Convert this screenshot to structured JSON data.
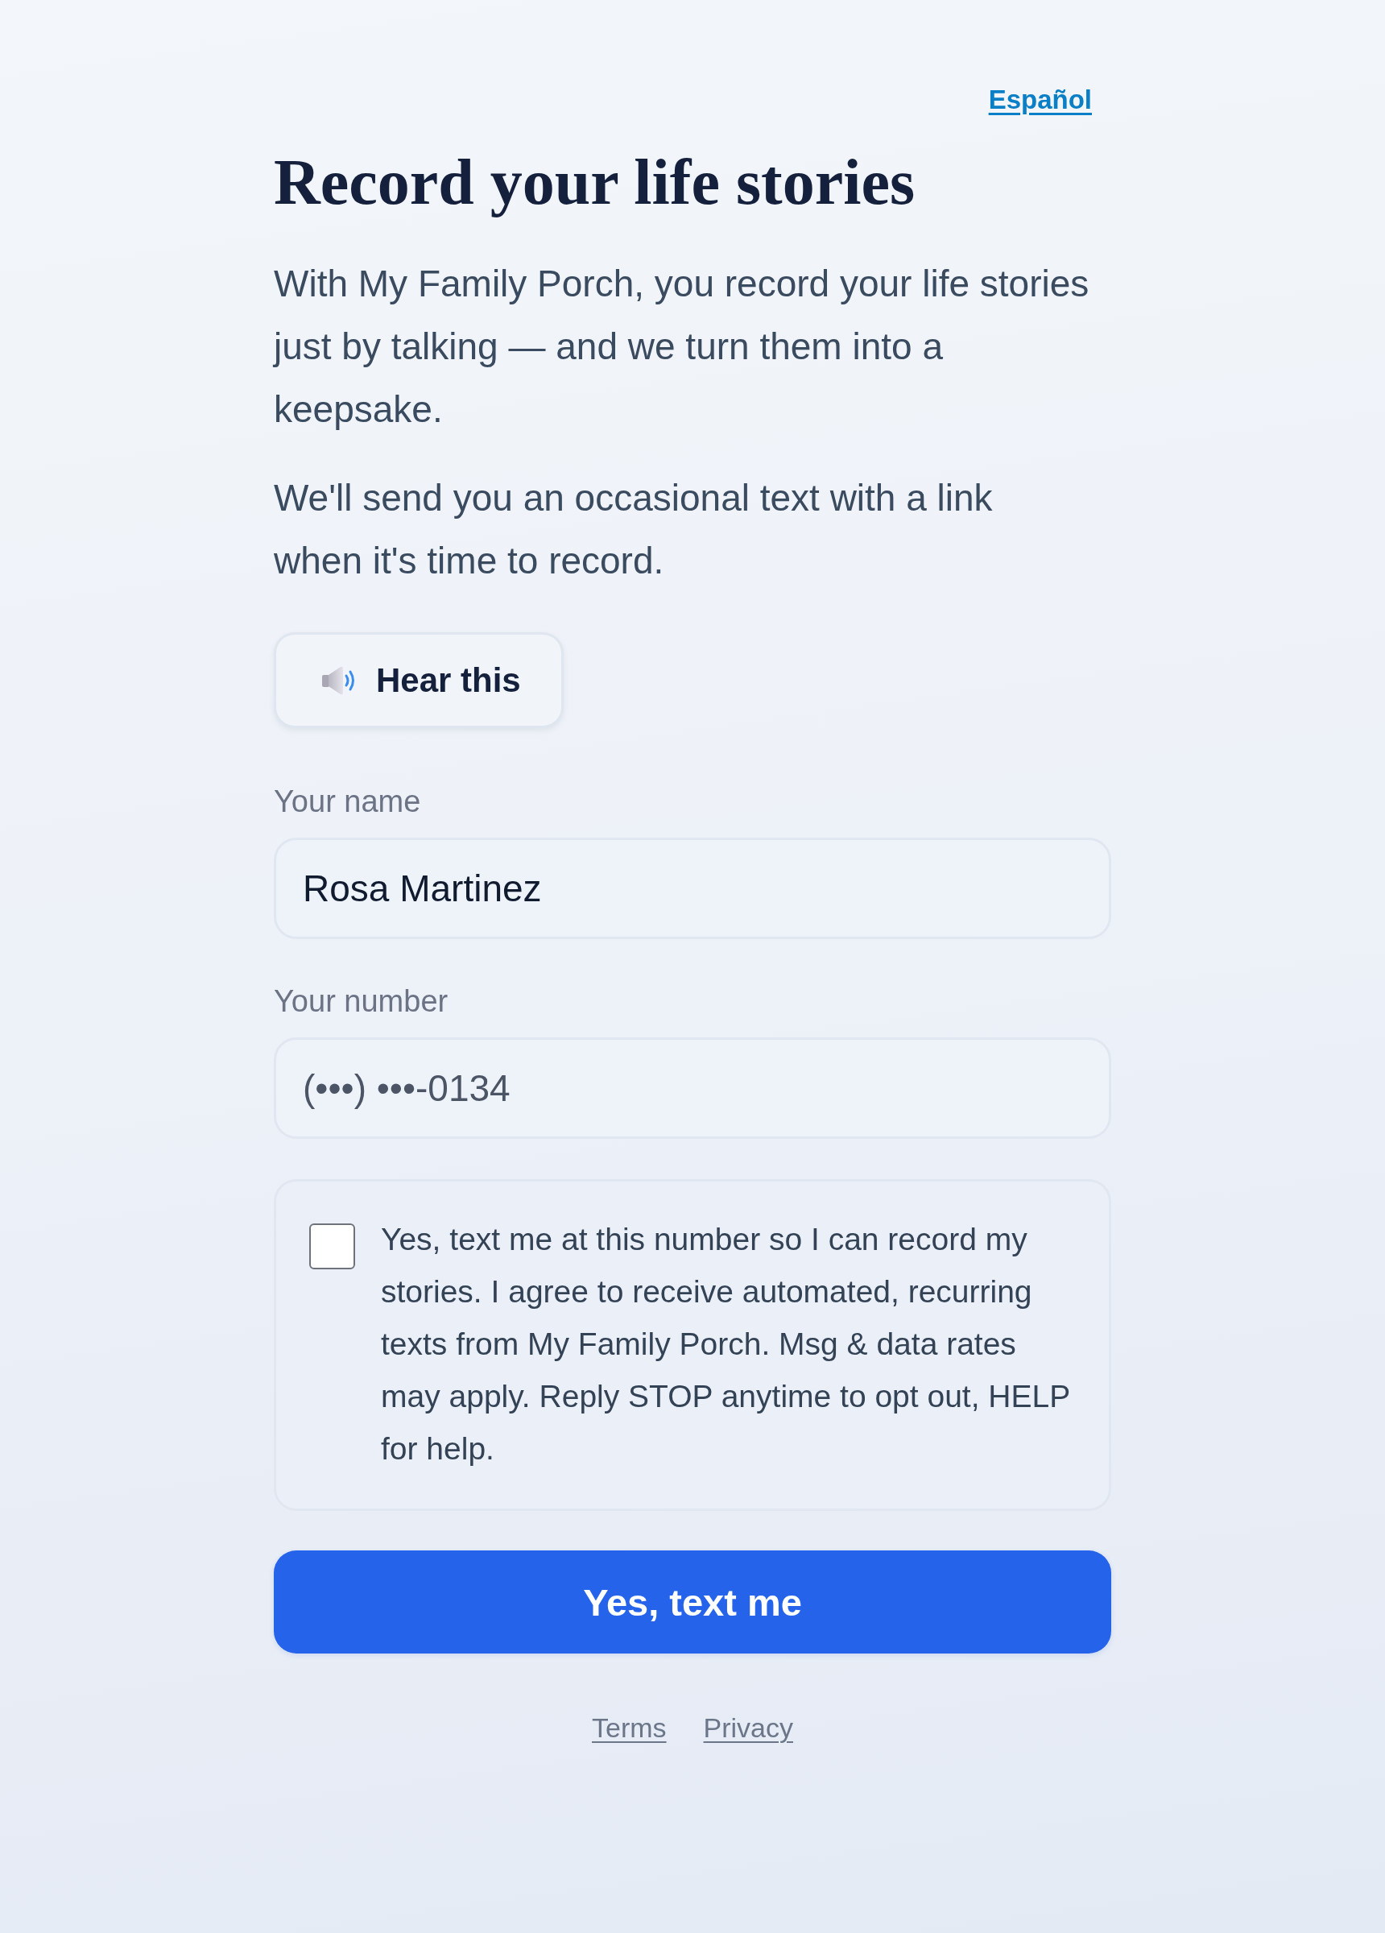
{
  "language_link": {
    "label": "Español"
  },
  "title": "Record your life stories",
  "intro": [
    "With My Family Porch, you record your life stories just by talking — and we turn them into a keepsake.",
    "We'll send you an occasional text with a link when it's time to record."
  ],
  "hear_button": {
    "label": "Hear this"
  },
  "fields": [
    {
      "kind": "text",
      "label": "Your name",
      "value": "Rosa Martinez"
    },
    {
      "kind": "phone",
      "label": "Your number",
      "value": "(•••) •••-0134"
    }
  ],
  "consent": {
    "checked": false,
    "text": "Yes, text me at this number so I can record my stories. I agree to receive automated, recurring texts from My Family Porch. Msg & data rates may apply. Reply STOP anytime to opt out, HELP for help."
  },
  "submit_button": {
    "label": "Yes, text me"
  },
  "footer_links": [
    "Terms",
    "Privacy"
  ]
}
